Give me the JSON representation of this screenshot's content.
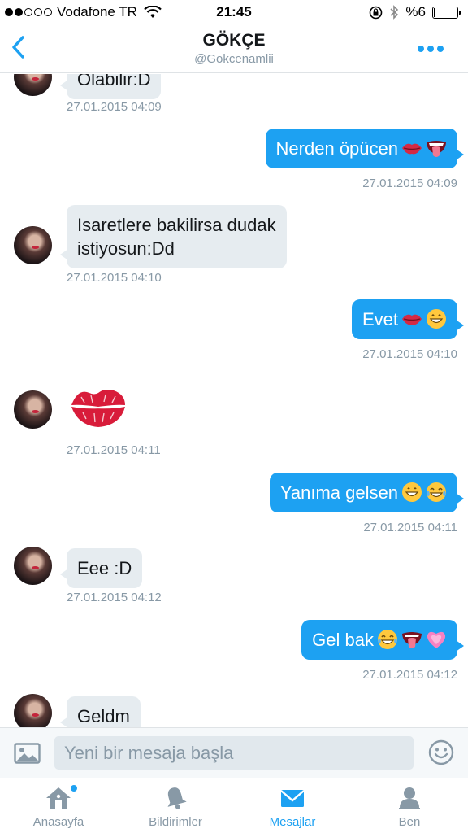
{
  "status_bar": {
    "carrier": "Vodafone TR",
    "time": "21:45",
    "battery": "%6",
    "battery_level": 0.06,
    "signal_bars_filled": 2,
    "signal_bars_total": 5
  },
  "nav": {
    "title": "GÖKÇE",
    "handle": "@Gokcenamlii"
  },
  "messages": [
    {
      "side": "in",
      "text": "Olabilir:D",
      "time": "27.01.2015 04:09",
      "avatar": true
    },
    {
      "side": "out",
      "text": "Nerden öpücen",
      "emojis": [
        "lips",
        "tongue-mouth"
      ],
      "time": "27.01.2015 04:09"
    },
    {
      "side": "in",
      "text_lines": [
        "Isaretlere bakilirsa dudak",
        "istiyosun:Dd"
      ],
      "time": "27.01.2015 04:10",
      "avatar": true
    },
    {
      "side": "out",
      "text": "Evet",
      "emojis": [
        "lips",
        "grin"
      ],
      "time": "27.01.2015 04:10"
    },
    {
      "side": "in",
      "sticker": "kiss-mark",
      "time": "27.01.2015 04:11",
      "avatar": true
    },
    {
      "side": "out",
      "text": "Yanıma gelsen",
      "emojis": [
        "grin",
        "tears-of-joy"
      ],
      "time": "27.01.2015 04:11"
    },
    {
      "side": "in",
      "text": "Eee :D",
      "time": "27.01.2015 04:12",
      "avatar": true
    },
    {
      "side": "out",
      "text": "Gel bak",
      "emojis": [
        "tears-of-joy",
        "tongue-mouth",
        "pink-heart"
      ],
      "time": "27.01.2015 04:12"
    },
    {
      "side": "in",
      "text": "Geldm",
      "avatar": true
    }
  ],
  "composer": {
    "placeholder": "Yeni bir mesaja başla",
    "photo_icon": "photo-icon",
    "emoji_icon": "smiley-icon"
  },
  "tabs": [
    {
      "label": "Anasayfa",
      "icon": "home-icon",
      "active": false,
      "badge": true
    },
    {
      "label": "Bildirimler",
      "icon": "bell-icon",
      "active": false
    },
    {
      "label": "Mesajlar",
      "icon": "envelope-icon",
      "active": true
    },
    {
      "label": "Ben",
      "icon": "person-icon",
      "active": false
    }
  ],
  "colors": {
    "accent": "#1da1f2",
    "incoming_bubble": "#e6ecf0",
    "muted": "#8899a6"
  }
}
